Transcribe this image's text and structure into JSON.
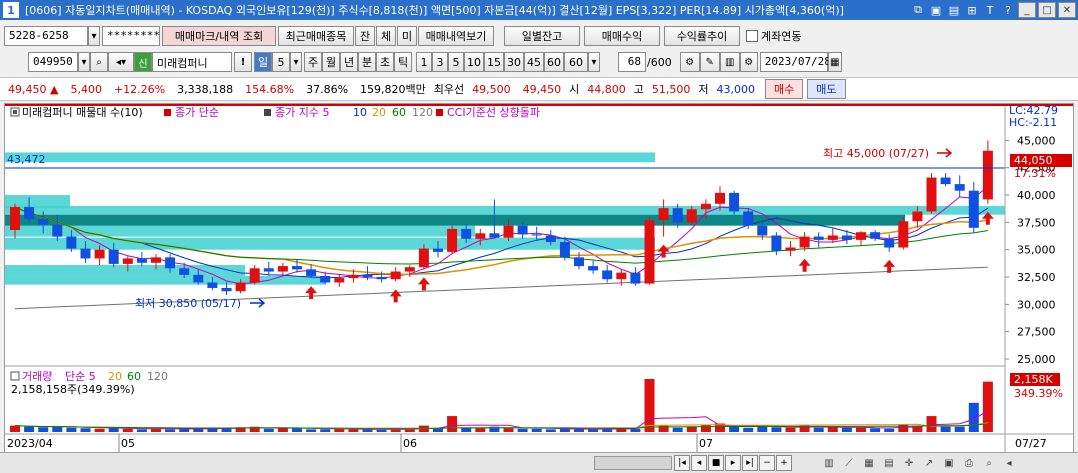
{
  "titlebar": {
    "index": "1",
    "text": "[0606] 자동일지차트(매매내역) - KOSDAQ 외국인보유[129(천)] 주식수[8,818(천)] 액면[500] 자본금[44(억)] 결산[12월] EPS[3,322] PER[14.89] 시가총액[4,360(억)]",
    "icons": [
      "⧉",
      "▣",
      "▤",
      "⊞",
      "T",
      "?"
    ],
    "window_buttons": [
      "_",
      "□",
      "✕"
    ]
  },
  "toolbar1": {
    "account": "5228-6258",
    "password": "********",
    "buttons": [
      "매매마크/내역 조회",
      "최근매매종목",
      "잔",
      "체",
      "미",
      "매매내역보기"
    ],
    "buttons2": [
      "일별잔고",
      "매매수익",
      "수익률추이"
    ],
    "checkbox_label": "계좌연동"
  },
  "toolbar2": {
    "stock_code": "049950",
    "stock_badge": "신",
    "stock_name": "미래컴퍼니",
    "period_buttons": [
      "일",
      "5",
      "주",
      "월",
      "년",
      "분",
      "초",
      "틱"
    ],
    "interval_buttons": [
      "1",
      "3",
      "5",
      "10",
      "15",
      "30",
      "45",
      "60",
      "60"
    ],
    "count": "68",
    "count_total": "/600",
    "date": "2023/07/28"
  },
  "quote": {
    "price": "49,450",
    "arrow": "▲",
    "change": "5,400",
    "change_pct": "+12.26%",
    "volume": "3,338,188",
    "vol_ratio": "154.68%",
    "turnover": "37.86%",
    "amount": "159,820백만",
    "best_label": "최우선",
    "best_ask": "49,500",
    "best_bid": "49,450",
    "open_label": "시",
    "open": "44,800",
    "high_label": "고",
    "high": "51,500",
    "low_label": "저",
    "low": "43,000",
    "buy_btn": "매수",
    "sell_btn": "매도"
  },
  "chart": {
    "legend": {
      "title": "미래컴퍼니 매물대 수(10)",
      "close_simple": "종가 단순",
      "close_index": "종가 지수 5",
      "p10": "10",
      "p20": "20",
      "p60": "60",
      "p120": "120",
      "cci": "CCI기준선 상향돌파"
    },
    "lc_label": "LC:42.79",
    "hc_label": "HC:-2.11",
    "left_level_label": "43,472",
    "max_label": "최고 45,000 (07/27)",
    "min_label": "최저 30,850 (05/17)",
    "current_tag": "44,050",
    "current_pct": "17.31%",
    "y_ticks": [
      "45,000",
      "42,500",
      "40,000",
      "37,500",
      "35,000",
      "32,500",
      "30,000",
      "27,500",
      "25,000"
    ],
    "vol_legend": {
      "label": "거래량",
      "simple": "단순 5",
      "p20": "20",
      "p60": "60",
      "p120": "120",
      "last": "2,158,158주(349.39%)"
    },
    "vol_tag": "2,158K",
    "vol_pct": "349.39%",
    "x_labels": [
      "2023/04",
      "05",
      "06",
      "07",
      "07/27"
    ]
  },
  "chart_data": {
    "type": "candlestick",
    "candles": [
      {
        "o": 36800,
        "h": 39200,
        "l": 36000,
        "c": 38900
      },
      {
        "o": 38900,
        "h": 39800,
        "l": 37500,
        "c": 37800
      },
      {
        "o": 37800,
        "h": 38500,
        "l": 36500,
        "c": 37300
      },
      {
        "o": 37300,
        "h": 38200,
        "l": 35800,
        "c": 36200
      },
      {
        "o": 36200,
        "h": 36800,
        "l": 34800,
        "c": 35100
      },
      {
        "o": 35100,
        "h": 35800,
        "l": 33800,
        "c": 34200
      },
      {
        "o": 34200,
        "h": 35400,
        "l": 33600,
        "c": 35000
      },
      {
        "o": 35000,
        "h": 35600,
        "l": 33400,
        "c": 33700
      },
      {
        "o": 33700,
        "h": 34400,
        "l": 33000,
        "c": 34200
      },
      {
        "o": 34200,
        "h": 34800,
        "l": 33500,
        "c": 33800
      },
      {
        "o": 33800,
        "h": 34600,
        "l": 33200,
        "c": 34300
      },
      {
        "o": 34300,
        "h": 34600,
        "l": 32900,
        "c": 33300
      },
      {
        "o": 33300,
        "h": 33800,
        "l": 32400,
        "c": 32700
      },
      {
        "o": 32700,
        "h": 33200,
        "l": 31800,
        "c": 32000
      },
      {
        "o": 32000,
        "h": 32500,
        "l": 31300,
        "c": 31500
      },
      {
        "o": 31500,
        "h": 32000,
        "l": 30850,
        "c": 31200
      },
      {
        "o": 31200,
        "h": 32300,
        "l": 31000,
        "c": 32000
      },
      {
        "o": 32000,
        "h": 33600,
        "l": 31800,
        "c": 33300
      },
      {
        "o": 33300,
        "h": 33900,
        "l": 32600,
        "c": 33000
      },
      {
        "o": 33000,
        "h": 33800,
        "l": 32600,
        "c": 33500
      },
      {
        "o": 33500,
        "h": 34100,
        "l": 32900,
        "c": 33200
      },
      {
        "o": 33200,
        "h": 33700,
        "l": 32400,
        "c": 32600
      },
      {
        "o": 32600,
        "h": 33000,
        "l": 31800,
        "c": 32000
      },
      {
        "o": 32000,
        "h": 32800,
        "l": 31600,
        "c": 32400
      },
      {
        "o": 32400,
        "h": 33200,
        "l": 32000,
        "c": 32700
      },
      {
        "o": 32700,
        "h": 33500,
        "l": 32200,
        "c": 32500
      },
      {
        "o": 32500,
        "h": 33000,
        "l": 32000,
        "c": 32300
      },
      {
        "o": 32300,
        "h": 33400,
        "l": 32100,
        "c": 33000
      },
      {
        "o": 33000,
        "h": 33600,
        "l": 32500,
        "c": 33400
      },
      {
        "o": 33400,
        "h": 35500,
        "l": 33200,
        "c": 35100
      },
      {
        "o": 35100,
        "h": 35800,
        "l": 34300,
        "c": 34800
      },
      {
        "o": 34800,
        "h": 37200,
        "l": 34600,
        "c": 36900
      },
      {
        "o": 36900,
        "h": 37400,
        "l": 35600,
        "c": 36000
      },
      {
        "o": 36000,
        "h": 36900,
        "l": 35400,
        "c": 36500
      },
      {
        "o": 36500,
        "h": 39600,
        "l": 36200,
        "c": 36100
      },
      {
        "o": 36100,
        "h": 37800,
        "l": 35800,
        "c": 37200
      },
      {
        "o": 37200,
        "h": 37500,
        "l": 36000,
        "c": 36400
      },
      {
        "o": 36400,
        "h": 37100,
        "l": 35800,
        "c": 36300
      },
      {
        "o": 36300,
        "h": 36800,
        "l": 35400,
        "c": 35700
      },
      {
        "o": 35700,
        "h": 36200,
        "l": 34000,
        "c": 34300
      },
      {
        "o": 34300,
        "h": 34800,
        "l": 33200,
        "c": 33500
      },
      {
        "o": 33500,
        "h": 34000,
        "l": 32800,
        "c": 33100
      },
      {
        "o": 33100,
        "h": 33600,
        "l": 32000,
        "c": 32300
      },
      {
        "o": 32300,
        "h": 33200,
        "l": 31700,
        "c": 32900
      },
      {
        "o": 32900,
        "h": 33400,
        "l": 31700,
        "c": 31900
      },
      {
        "o": 31900,
        "h": 38000,
        "l": 31800,
        "c": 37700
      },
      {
        "o": 37700,
        "h": 39600,
        "l": 36200,
        "c": 38800
      },
      {
        "o": 38800,
        "h": 39200,
        "l": 37000,
        "c": 37500
      },
      {
        "o": 37500,
        "h": 39000,
        "l": 37200,
        "c": 38700
      },
      {
        "o": 38700,
        "h": 39600,
        "l": 37800,
        "c": 39200
      },
      {
        "o": 39200,
        "h": 40800,
        "l": 38600,
        "c": 40200
      },
      {
        "o": 40200,
        "h": 40400,
        "l": 38200,
        "c": 38500
      },
      {
        "o": 38500,
        "h": 38800,
        "l": 36900,
        "c": 37200
      },
      {
        "o": 37200,
        "h": 37500,
        "l": 35900,
        "c": 36300
      },
      {
        "o": 36300,
        "h": 36600,
        "l": 34500,
        "c": 34900
      },
      {
        "o": 34900,
        "h": 35800,
        "l": 34400,
        "c": 35200
      },
      {
        "o": 35200,
        "h": 36600,
        "l": 34900,
        "c": 36200
      },
      {
        "o": 36200,
        "h": 36600,
        "l": 35200,
        "c": 35900
      },
      {
        "o": 35900,
        "h": 37000,
        "l": 35600,
        "c": 36300
      },
      {
        "o": 36300,
        "h": 36800,
        "l": 35500,
        "c": 35900
      },
      {
        "o": 35900,
        "h": 36700,
        "l": 35400,
        "c": 36600
      },
      {
        "o": 36600,
        "h": 36800,
        "l": 35800,
        "c": 36000
      },
      {
        "o": 36000,
        "h": 36400,
        "l": 34800,
        "c": 35200
      },
      {
        "o": 35200,
        "h": 38000,
        "l": 35000,
        "c": 37600
      },
      {
        "o": 37600,
        "h": 39000,
        "l": 37000,
        "c": 38500
      },
      {
        "o": 38500,
        "h": 42000,
        "l": 38300,
        "c": 41600
      },
      {
        "o": 41600,
        "h": 42000,
        "l": 40800,
        "c": 41000
      },
      {
        "o": 41000,
        "h": 41800,
        "l": 39800,
        "c": 40400
      },
      {
        "o": 40400,
        "h": 41200,
        "l": 36500,
        "c": 37000
      },
      {
        "o": 39600,
        "h": 45000,
        "l": 39200,
        "c": 44050
      }
    ],
    "volumes": [
      0.12,
      0.1,
      0.09,
      0.1,
      0.08,
      0.07,
      0.06,
      0.08,
      0.06,
      0.05,
      0.06,
      0.05,
      0.07,
      0.06,
      0.07,
      0.08,
      0.09,
      0.1,
      0.06,
      0.07,
      0.07,
      0.05,
      0.05,
      0.06,
      0.05,
      0.05,
      0.04,
      0.05,
      0.06,
      0.12,
      0.08,
      0.3,
      0.08,
      0.07,
      0.1,
      0.08,
      0.06,
      0.06,
      0.05,
      0.06,
      0.05,
      0.05,
      0.06,
      0.07,
      0.06,
      1.0,
      0.12,
      0.08,
      0.1,
      0.14,
      0.16,
      0.1,
      0.08,
      0.1,
      0.09,
      0.08,
      0.12,
      0.08,
      0.09,
      0.08,
      0.08,
      0.07,
      0.06,
      0.14,
      0.12,
      0.3,
      0.12,
      0.1,
      0.55,
      0.95
    ],
    "ylim": [
      25000,
      46500
    ]
  }
}
